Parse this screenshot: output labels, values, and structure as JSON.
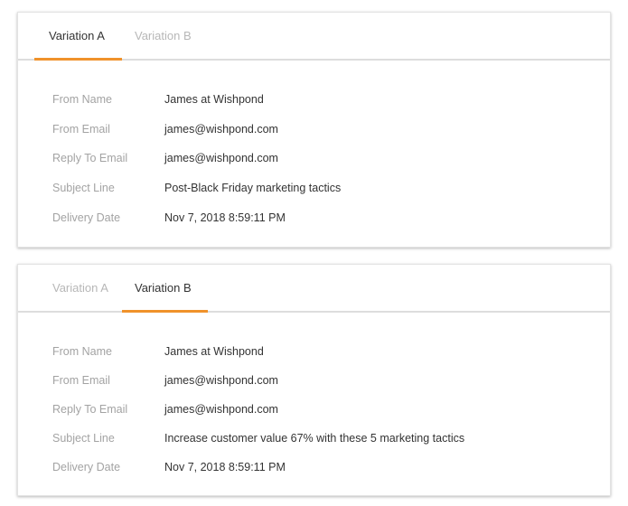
{
  "cards": [
    {
      "tabs": [
        {
          "label": "Variation A",
          "active": true
        },
        {
          "label": "Variation B",
          "active": false
        }
      ],
      "fields": [
        {
          "label": "From Name",
          "value": "James at Wishpond"
        },
        {
          "label": "From Email",
          "value": "james@wishpond.com"
        },
        {
          "label": "Reply To Email",
          "value": "james@wishpond.com"
        },
        {
          "label": "Subject Line",
          "value": "Post-Black Friday marketing tactics"
        },
        {
          "label": "Delivery Date",
          "value": "Nov 7, 2018 8:59:11 PM"
        }
      ]
    },
    {
      "tabs": [
        {
          "label": "Variation A",
          "active": false
        },
        {
          "label": "Variation B",
          "active": true
        }
      ],
      "fields": [
        {
          "label": "From Name",
          "value": "James at Wishpond"
        },
        {
          "label": "From Email",
          "value": "james@wishpond.com"
        },
        {
          "label": "Reply To Email",
          "value": "james@wishpond.com"
        },
        {
          "label": "Subject Line",
          "value": "Increase customer value 67% with these 5 marketing tactics"
        },
        {
          "label": "Delivery Date",
          "value": "Nov 7, 2018 8:59:11 PM"
        }
      ]
    }
  ],
  "colors": {
    "accent": "#f0922b",
    "label": "#a3a3a3",
    "value": "#333333",
    "inactive_tab": "#b7b7b7"
  }
}
